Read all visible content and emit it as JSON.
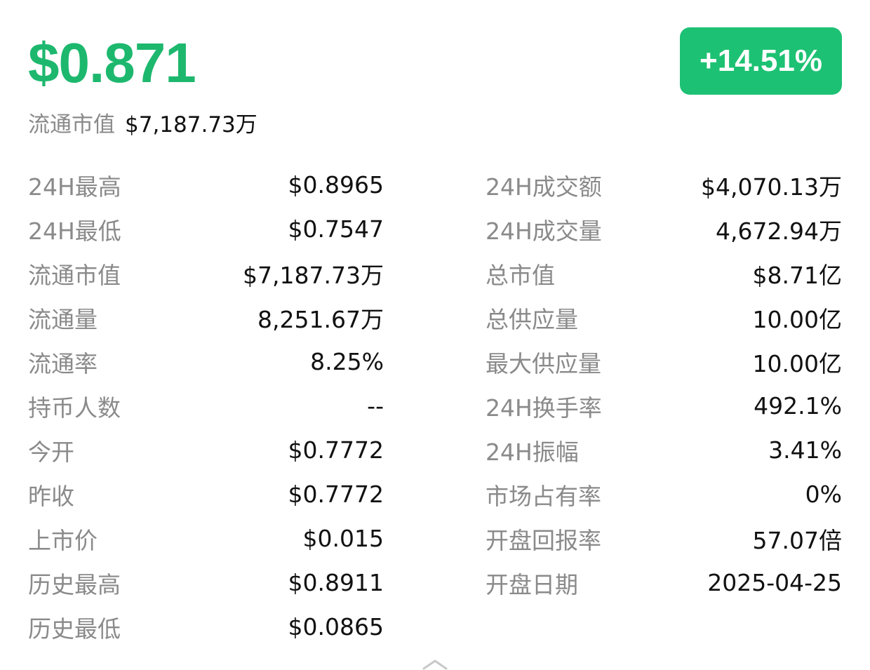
{
  "header": {
    "price": "$0.871",
    "change": "+14.51%",
    "circ_mcap_label": "流通市值",
    "circ_mcap_value": "$7,187.73万"
  },
  "colors": {
    "accent_green": "#1db86e",
    "badge_green": "#1dc173",
    "label_gray": "#8a8a8a",
    "value_black": "#111111"
  },
  "stats": {
    "left": [
      {
        "label": "24H最高",
        "value": "$0.8965"
      },
      {
        "label": "24H最低",
        "value": "$0.7547"
      },
      {
        "label": "流通市值",
        "value": "$7,187.73万"
      },
      {
        "label": "流通量",
        "value": "8,251.67万"
      },
      {
        "label": "流通率",
        "value": "8.25%"
      },
      {
        "label": "持币人数",
        "value": "--"
      },
      {
        "label": "今开",
        "value": "$0.7772"
      },
      {
        "label": "昨收",
        "value": "$0.7772"
      },
      {
        "label": "上市价",
        "value": "$0.015"
      },
      {
        "label": "历史最高",
        "value": "$0.8911"
      },
      {
        "label": "历史最低",
        "value": "$0.0865"
      }
    ],
    "right": [
      {
        "label": "24H成交额",
        "value": "$4,070.13万"
      },
      {
        "label": "24H成交量",
        "value": "4,672.94万"
      },
      {
        "label": "总市值",
        "value": "$8.71亿"
      },
      {
        "label": "总供应量",
        "value": "10.00亿"
      },
      {
        "label": "最大供应量",
        "value": "10.00亿"
      },
      {
        "label": "24H换手率",
        "value": "492.1%"
      },
      {
        "label": "24H振幅",
        "value": "3.41%"
      },
      {
        "label": "市场占有率",
        "value": "0%"
      },
      {
        "label": "开盘回报率",
        "value": "57.07倍"
      },
      {
        "label": "开盘日期",
        "value": "2025-04-25"
      }
    ]
  },
  "footer": {
    "collapse_icon": "chevron-up-icon"
  }
}
